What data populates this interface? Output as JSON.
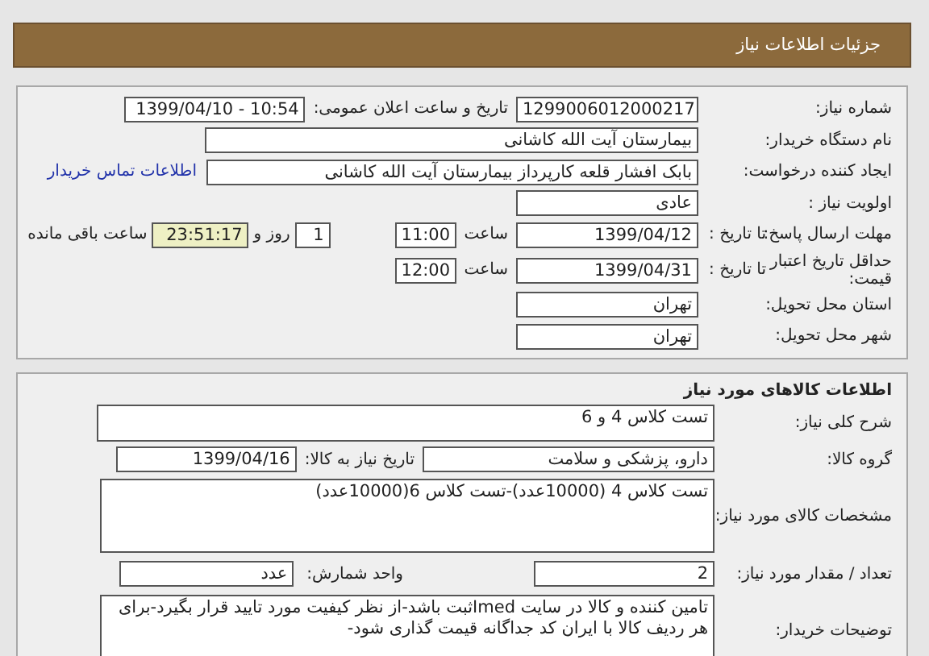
{
  "header": {
    "title": "جزئیات اطلاعات نیاز"
  },
  "need_info": {
    "need_number": {
      "label": "شماره نیاز:",
      "value": "1299006012000217"
    },
    "announce": {
      "label": "تاریخ و ساعت اعلان عمومی:",
      "value": "1399/04/10 - 10:54"
    },
    "buyer_org": {
      "label": "نام دستگاه خریدار:",
      "value": "بیمارستان آیت الله کاشانی"
    },
    "requester": {
      "label": "ایجاد کننده درخواست:",
      "value": "بابک افشار قلعه کارپرداز بیمارستان آیت الله کاشانی"
    },
    "contact_link": "اطلاعات تماس خریدار",
    "priority": {
      "label": "اولویت نیاز :",
      "value": "عادی"
    },
    "response_deadline": {
      "label": "مهلت ارسال پاسخ:",
      "sublabel": "تا تاریخ :",
      "date": "1399/04/12",
      "time_label": "ساعت",
      "time": "11:00",
      "days": "1",
      "days_label": "روز و",
      "remaining": "23:51:17",
      "remaining_label": "ساعت باقی مانده"
    },
    "validity": {
      "label": "حداقل تاریخ اعتبار قیمت:",
      "sublabel": "تا تاریخ :",
      "date": "1399/04/31",
      "time_label": "ساعت",
      "time": "12:00"
    },
    "province": {
      "label": "استان محل تحویل:",
      "value": "تهران"
    },
    "city": {
      "label": "شهر محل تحویل:",
      "value": "تهران"
    }
  },
  "goods": {
    "title": "اطلاعات کالاهای مورد نیاز",
    "description": {
      "label": "شرح کلی نیاز:",
      "value": "تست کلاس 4 و 6"
    },
    "group": {
      "label": "گروه کالا:",
      "value": "دارو، پزشکی و سلامت"
    },
    "need_date": {
      "label": "تاریخ نیاز به کالا:",
      "value": "1399/04/16"
    },
    "specs": {
      "label": "مشخصات کالای مورد نیاز:",
      "value": "تست کلاس 4 (10000عدد)-تست کلاس 6(10000عدد)"
    },
    "quantity": {
      "label": "تعداد / مقدار مورد نیاز:",
      "value": "2"
    },
    "unit": {
      "label": "واحد شمارش:",
      "value": "عدد"
    },
    "buyer_notes": {
      "label": "توضیحات خریدار:",
      "value": "تامین کننده و کالا در سایت Imedثبت باشد-از نظر کیفیت مورد تایید قرار بگیرد-برای هر ردیف کالا با ایران کد جداگانه قیمت گذاری شود-"
    }
  }
}
